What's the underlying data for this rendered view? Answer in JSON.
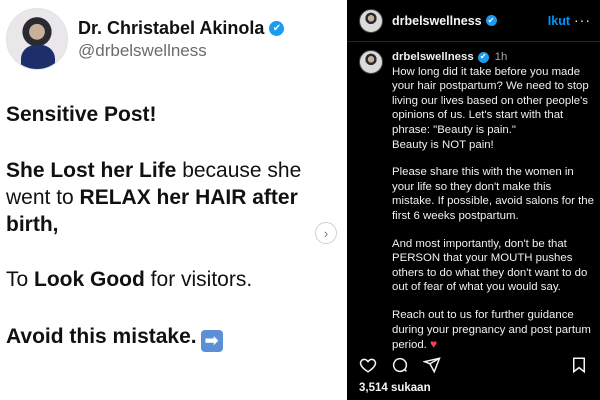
{
  "left_post": {
    "profile_name": "Dr. Christabel Akinola",
    "verified_mark": "✔",
    "profile_handle": "@drbelswellness",
    "line_sensitive": "Sensitive Post!",
    "main_1_bold": "She Lost her Life",
    "main_2": " because she went to ",
    "main_3_bold": "RELAX her HAIR after birth,",
    "look_1": "To ",
    "look_2_bold": "Look Good",
    "look_3": " for visitors.",
    "avoid": "Avoid this mistake.",
    "avoid_emoji": "➡",
    "next_icon_glyph": "›"
  },
  "header": {
    "username": "drbelswellness",
    "verified_mark": "✔",
    "follow_label": "Ikut",
    "more_glyph": "···"
  },
  "comment": {
    "username": "drbelswellness",
    "time": "1h",
    "paragraphs": {
      "p1": "How long did it take before you made your hair postpartum? We need to stop living our lives based on other people's opinions of us. Let's start with that phrase: \"Beauty is pain.\"\nBeauty is NOT pain!",
      "p2": "Please share this with the women in your life so they don't make this mistake. If possible, avoid salons for the first 6 weeks postpartum.",
      "p3": "And most importantly, don't be that PERSON that your MOUTH pushes others to do what they don't want to do out of fear of what you would say.",
      "p4": "Reach out to us for further guidance during your pregnancy and post partum period.",
      "heart": "♥"
    }
  },
  "footer": {
    "likes": "3,514 sukaan"
  },
  "colors": {
    "accent_blue": "#0095f6",
    "verified_blue": "#1d9bf0",
    "panel_dark": "#000000",
    "heart_red": "#ff3b5c"
  },
  "icons": [
    "heart-icon",
    "comment-icon",
    "share-icon",
    "bookmark-icon",
    "more-icon",
    "verified-icon",
    "chevron-right-icon"
  ]
}
